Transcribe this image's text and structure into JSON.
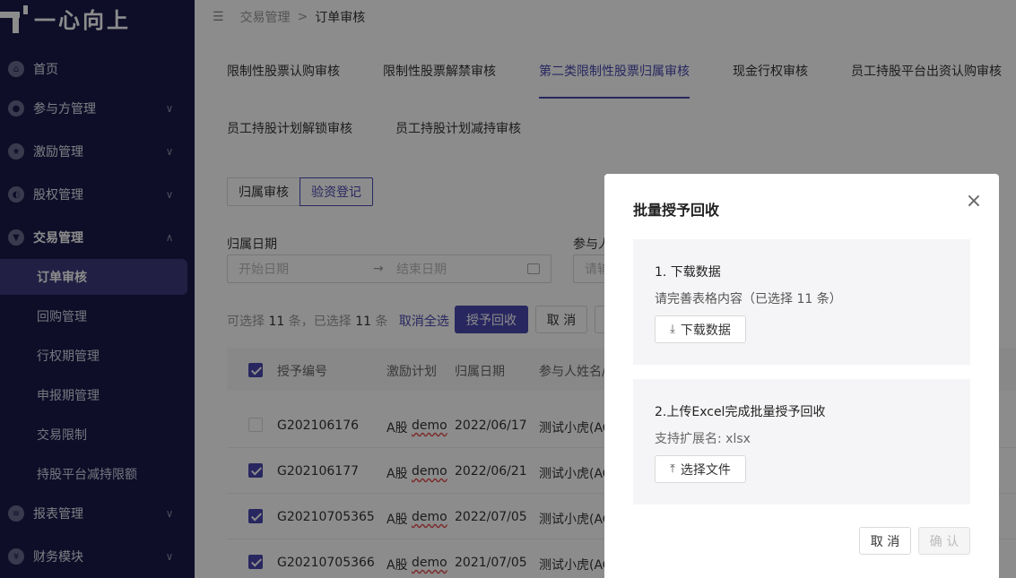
{
  "app": {
    "logo_text": "一心向上"
  },
  "sidebar": {
    "items": [
      {
        "label": "首页",
        "icon": "home-icon",
        "chevron": ""
      },
      {
        "label": "参与方管理",
        "icon": "users-icon",
        "chevron": "∨"
      },
      {
        "label": "激励管理",
        "icon": "star-icon",
        "chevron": "∨"
      },
      {
        "label": "股权管理",
        "icon": "equity-icon",
        "chevron": "∨"
      },
      {
        "label": "交易管理",
        "icon": "trade-icon",
        "chevron": "∧"
      },
      {
        "label": "报表管理",
        "icon": "report-icon",
        "chevron": "∨"
      },
      {
        "label": "财务模块",
        "icon": "finance-icon",
        "chevron": "∨"
      }
    ],
    "sub_items": [
      "订单审核",
      "回购管理",
      "行权期管理",
      "申报期管理",
      "交易限制",
      "持股平台减持限额"
    ]
  },
  "breadcrumb": {
    "parent": "交易管理",
    "sep": ">",
    "current": "订单审核"
  },
  "tabs": [
    "限制性股票认购审核",
    "限制性股票解禁审核",
    "第二类限制性股票归属审核",
    "现金行权审核",
    "员工持股平台出资认购审核",
    "员工持股计划解锁审核",
    "员工持股计划减持审核"
  ],
  "segments": [
    "归属审核",
    "验资登记"
  ],
  "filters": {
    "date_label": "归属日期",
    "start_placeholder": "开始日期",
    "arrow": "→",
    "end_placeholder": "结束日期",
    "participant_label": "参与人",
    "participant_placeholder": "请输"
  },
  "selection": {
    "prefix": "可选择",
    "total": "11",
    "mid": "条，已选择",
    "selected": "11",
    "suffix": "条",
    "cancel_all": "取消全选",
    "grant_recall": "授予回收",
    "cancel": "取 消"
  },
  "table": {
    "headers": [
      "授予编号",
      "激励计划",
      "归属日期",
      "参与人姓名/"
    ],
    "rows": [
      {
        "checked": false,
        "id": "G202106176",
        "plan_a": "A股",
        "plan_b": "demo",
        "date": "2022/06/17",
        "name": "测试小虎(AC"
      },
      {
        "checked": true,
        "id": "G202106177",
        "plan_a": "A股",
        "plan_b": "demo",
        "date": "2022/06/21",
        "name": "测试小虎(AC"
      },
      {
        "checked": true,
        "id": "G20210705365",
        "plan_a": "A股",
        "plan_b": "demo",
        "date": "2022/07/05",
        "name": "测试小虎(AC"
      },
      {
        "checked": true,
        "id": "G20210705366",
        "plan_a": "A股",
        "plan_b": "demo",
        "date": "2021/07/05",
        "name": "测试小虎(AC"
      }
    ]
  },
  "modal": {
    "title": "批量授予回收",
    "close_glyph": "×",
    "step1_title": "1. 下载数据",
    "step1_hint": "请完善表格内容（已选择 11 条）",
    "step1_button": "下载数据",
    "step2_title": "2.上传Excel完成批量授予回收",
    "step2_hint": "支持扩展名: xlsx",
    "step2_button": "选择文件",
    "cancel": "取 消",
    "confirm": "确 认"
  },
  "colors": {
    "sidebar_bg": "#1b1b4b",
    "accent": "#4a47b0",
    "overlay": "rgba(0,0,0,0.45)"
  }
}
